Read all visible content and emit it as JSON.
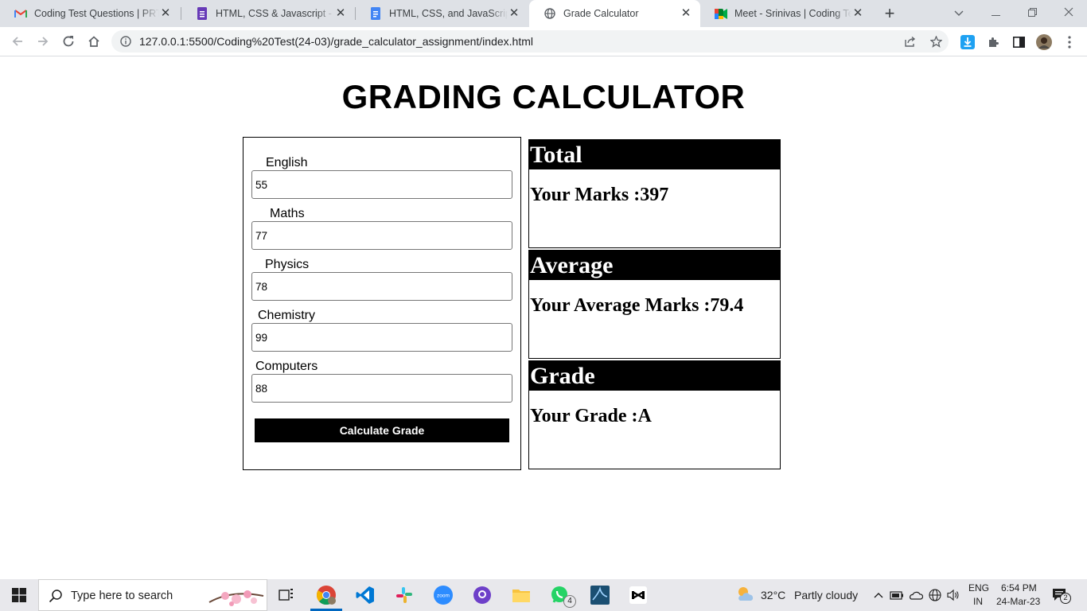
{
  "browser": {
    "tabs": [
      {
        "title": "Coding Test Questions | PRT",
        "icon": "gmail-icon"
      },
      {
        "title": "HTML, CSS & Javascript - Gra",
        "icon": "forms-icon"
      },
      {
        "title": "HTML, CSS, and JavaScript - C",
        "icon": "docs-icon"
      },
      {
        "title": "Grade Calculator",
        "icon": "globe-icon"
      },
      {
        "title": "Meet - Srinivas | Coding Test",
        "icon": "meet-icon"
      }
    ],
    "active_tab_index": 3,
    "new_tab_label": "+",
    "url": "127.0.0.1:5500/Coding%20Test(24-03)/grade_calculator_assignment/index.html"
  },
  "page": {
    "title": "GRADING CALCULATOR",
    "subjects": [
      {
        "label": "English",
        "value": "55"
      },
      {
        "label": "Maths",
        "value": "77"
      },
      {
        "label": "Physics",
        "value": "78"
      },
      {
        "label": "Chemistry",
        "value": "99"
      },
      {
        "label": "Computers",
        "value": "88"
      }
    ],
    "button_label": "Calculate Grade",
    "results": [
      {
        "heading": "Total",
        "text": "Your Marks :397"
      },
      {
        "heading": "Average",
        "text": "Your Average Marks :79.4"
      },
      {
        "heading": "Grade",
        "text": "Your Grade :A"
      }
    ]
  },
  "taskbar": {
    "search_placeholder": "Type here to search",
    "weather_temp": "32°C",
    "weather_text": "Partly cloudy",
    "language_top": "ENG",
    "language_bottom": "IN",
    "time": "6:54 PM",
    "date": "24-Mar-23",
    "whatsapp_badge": "4",
    "notification_count": "2"
  }
}
